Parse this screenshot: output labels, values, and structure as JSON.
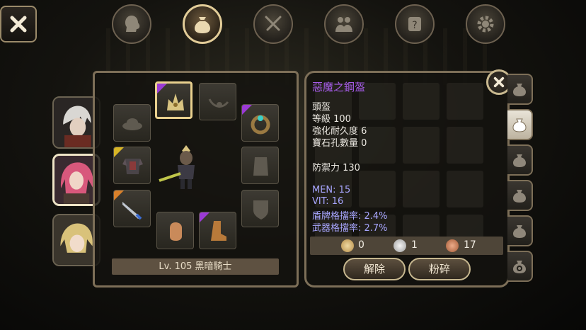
{
  "nav": {
    "tabs": [
      {
        "icon": "head-silhouette-icon",
        "active": false
      },
      {
        "icon": "bag-icon",
        "active": true
      },
      {
        "icon": "swords-icon",
        "active": false
      },
      {
        "icon": "people-icon",
        "active": false
      },
      {
        "icon": "scroll-icon",
        "active": false
      },
      {
        "icon": "gear-icon",
        "active": false
      }
    ]
  },
  "character": {
    "level_label": "Lv. 105 黑暗騎士"
  },
  "item": {
    "name": "惡魔之鋼盔",
    "type": "頭盔",
    "level": "等級 100",
    "durability": "強化耐久度 6",
    "gem_slots": "寶石孔數量 0",
    "defense": "防禦力 130",
    "stats": [
      "MEN: 15",
      "VIT: 16",
      "盾牌格擋率: 2.4%",
      "武器格擋率: 2.7%"
    ],
    "name_color": "#a55be8",
    "stat_color": "#a8a6ff"
  },
  "currency": {
    "gold": "0",
    "silver": "1",
    "copper": "17"
  },
  "buttons": {
    "unequip": "解除",
    "smash": "粉碎"
  }
}
